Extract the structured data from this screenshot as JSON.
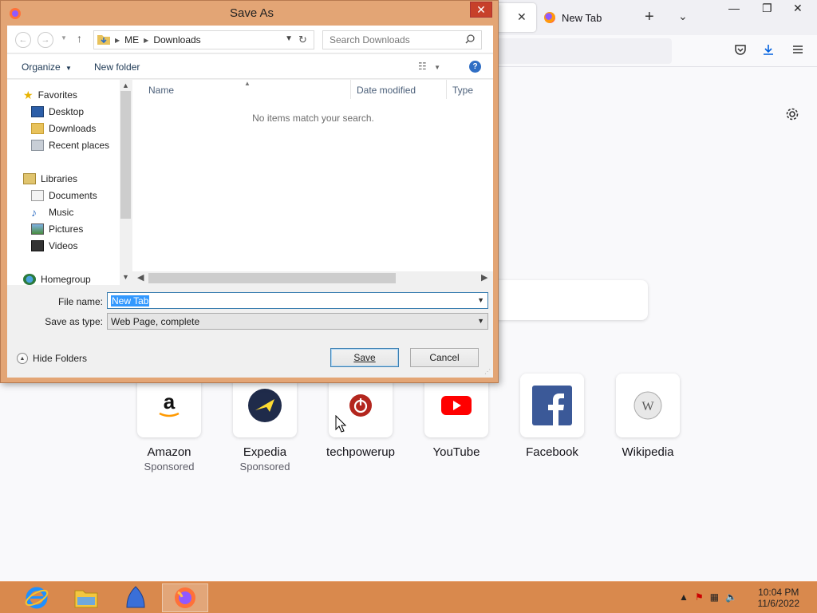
{
  "colors": {
    "taskbar": "#d9894d",
    "dialog_frame": "#e3a575",
    "close_button": "#c7402a",
    "selection": "#3399ff"
  },
  "browser": {
    "tab_active_close": "✕",
    "tab2_label": "New Tab",
    "new_tab_symbol": "+",
    "list_all_symbol": "⌄",
    "window_controls": {
      "minimize": "—",
      "restore": "❐",
      "close": "✕"
    },
    "toolbar_icons": [
      "pocket-icon",
      "download-icon",
      "menu-icon"
    ],
    "settings_icon": "gear-icon",
    "top_sites": [
      {
        "name": "Amazon",
        "sponsor": "Sponsored",
        "icon": "amazon-icon"
      },
      {
        "name": "Expedia",
        "sponsor": "Sponsored",
        "icon": "expedia-icon"
      },
      {
        "name": "techpowerup",
        "sponsor": "",
        "icon": "techpowerup-icon"
      },
      {
        "name": "YouTube",
        "sponsor": "",
        "icon": "youtube-icon"
      },
      {
        "name": "Facebook",
        "sponsor": "",
        "icon": "facebook-icon"
      },
      {
        "name": "Wikipedia",
        "sponsor": "",
        "icon": "wikipedia-icon"
      }
    ]
  },
  "dialog": {
    "title": "Save As",
    "close_symbol": "✕",
    "address": {
      "segments": [
        "ME",
        "Downloads"
      ]
    },
    "search_placeholder": "Search Downloads",
    "organize_label": "Organize",
    "new_folder_label": "New folder",
    "help_symbol": "?",
    "nav": {
      "favorites_label": "Favorites",
      "favorites": [
        "Desktop",
        "Downloads",
        "Recent places"
      ],
      "libraries_label": "Libraries",
      "libraries": [
        "Documents",
        "Music",
        "Pictures",
        "Videos"
      ],
      "homegroup_label": "Homegroup"
    },
    "columns": {
      "name": "Name",
      "date": "Date modified",
      "type": "Type"
    },
    "empty_message": "No items match your search.",
    "file_name_label": "File name:",
    "file_name_value": "New Tab",
    "save_type_label": "Save as type:",
    "save_type_value": "Web Page, complete",
    "hide_folders_label": "Hide Folders",
    "save_label": "Save",
    "cancel_label": "Cancel"
  },
  "taskbar": {
    "apps": [
      "internet-explorer-icon",
      "file-explorer-icon",
      "app-icon",
      "firefox-icon"
    ],
    "clock_time": "10:04 PM",
    "clock_date": "11/6/2022"
  }
}
